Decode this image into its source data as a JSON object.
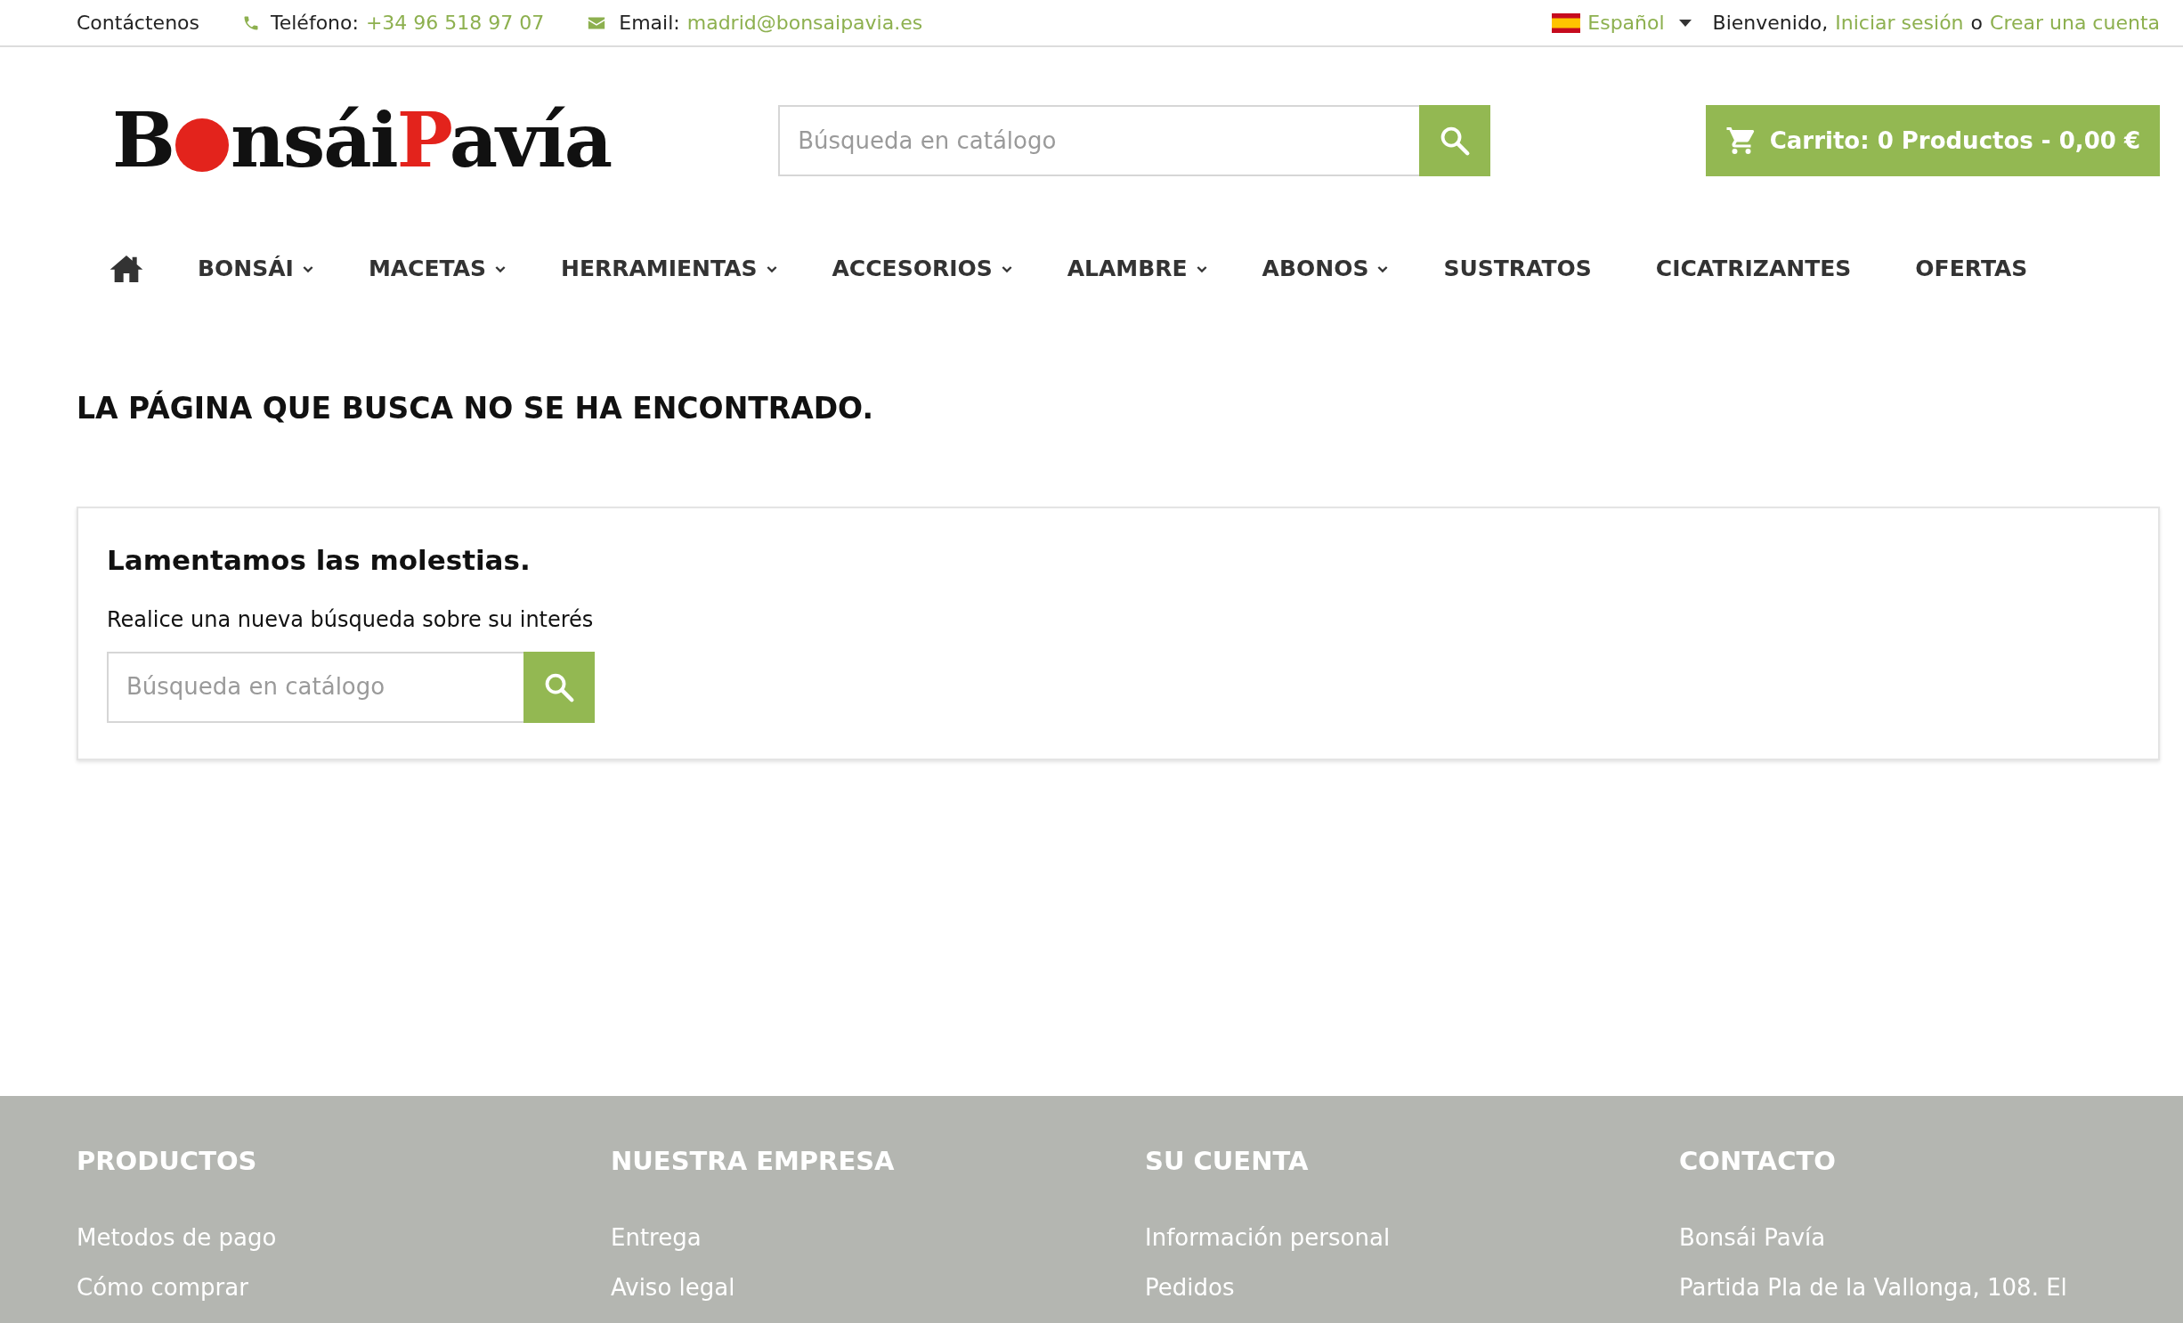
{
  "top_bar": {
    "contact": "Contáctenos",
    "phone_label": "Teléfono:",
    "phone": "+34 96 518 97 07",
    "email_label": "Email:",
    "email": "madrid@bonsaipavia.es",
    "language": "Español",
    "welcome": "Bienvenido,",
    "login": "Iniciar sesión",
    "or": "o",
    "register": "Crear una cuenta"
  },
  "logo": {
    "parts": [
      {
        "kind": "text",
        "text": "B",
        "color": "#111111"
      },
      {
        "kind": "dot",
        "color": "#e3231c"
      },
      {
        "kind": "text",
        "text": "nsái",
        "color": "#111111"
      },
      {
        "kind": "text",
        "text": "P",
        "color": "#e3231c"
      },
      {
        "kind": "text",
        "text": "avía",
        "color": "#111111"
      }
    ]
  },
  "search": {
    "placeholder": "Búsqueda en catálogo"
  },
  "cart": {
    "label": "Carrito: 0 Productos - 0,00 €"
  },
  "menu": [
    {
      "label": "BONSÁI",
      "dropdown": true
    },
    {
      "label": "MACETAS",
      "dropdown": true
    },
    {
      "label": "HERRAMIENTAS",
      "dropdown": true
    },
    {
      "label": "ACCESORIOS",
      "dropdown": true
    },
    {
      "label": "ALAMBRE",
      "dropdown": true
    },
    {
      "label": "ABONOS",
      "dropdown": true
    },
    {
      "label": "SUSTRATOS",
      "dropdown": false
    },
    {
      "label": "CICATRIZANTES",
      "dropdown": false
    },
    {
      "label": "OFERTAS",
      "dropdown": false
    }
  ],
  "page_title": "LA PÁGINA QUE BUSCA NO SE HA ENCONTRADO.",
  "notice": {
    "heading": "Lamentamos las molestias.",
    "text": "Realice una nueva búsqueda sobre su interés",
    "search": {
      "placeholder": "Búsqueda en catálogo"
    }
  },
  "footer": [
    {
      "heading": "PRODUCTOS",
      "links": [
        "Metodos de pago",
        "Cómo comprar"
      ]
    },
    {
      "heading": "NUESTRA EMPRESA",
      "links": [
        "Entrega",
        "Aviso legal"
      ]
    },
    {
      "heading": "SU CUENTA",
      "links": [
        "Información personal",
        "Pedidos"
      ]
    },
    {
      "heading": "CONTACTO",
      "links": [
        "Bonsái Pavía",
        "Partida Pla de la Vallonga, 108. El"
      ]
    }
  ]
}
